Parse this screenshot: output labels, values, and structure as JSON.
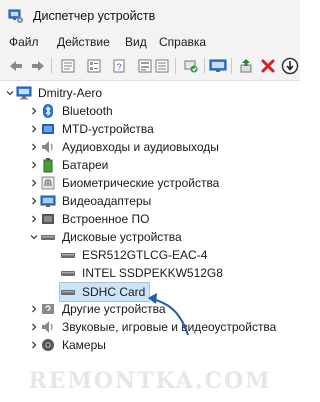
{
  "window": {
    "title": "Диспетчер устройств"
  },
  "menu": [
    "Файл",
    "Действие",
    "Вид",
    "Справка"
  ],
  "tree": {
    "root": "Dmitry-Aero",
    "categories": [
      "Bluetooth",
      "MTD-устройства",
      "Аудиовходы и аудиовыходы",
      "Батареи",
      "Биометрические устройства",
      "Видеоадаптеры",
      "Встроенное ПО",
      "Дисковые устройства",
      "Другие устройства",
      "Звуковые, игровые и видеоустройства",
      "Камеры"
    ],
    "disks": [
      "ESR512GTLCG-EAC-4",
      "INTEL SSDPEKKW512G8",
      "SDHC Card"
    ]
  },
  "watermark": "REMONTKA.COM",
  "colors": {
    "accent": "#1f5fa8",
    "selection": "#cce4f7",
    "remove_red": "#d92020",
    "green_arrow": "#1f8a2a"
  }
}
